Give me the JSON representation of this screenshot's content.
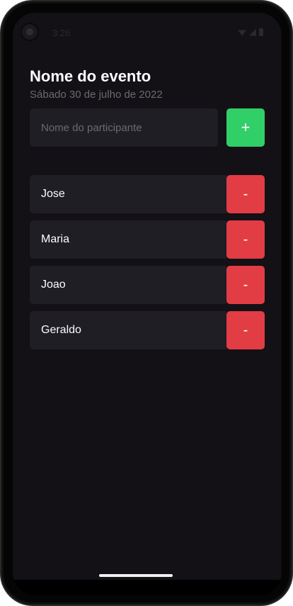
{
  "status_bar": {
    "time": "3:26",
    "icons": [
      "wifi-icon",
      "signal-icon",
      "battery-icon"
    ]
  },
  "event": {
    "title": "Nome do evento",
    "date": "Sábado 30 de julho de 2022"
  },
  "form": {
    "placeholder": "Nome do participante",
    "value": "",
    "add_label": "+"
  },
  "participants": [
    {
      "name": "Jose",
      "remove_label": "-"
    },
    {
      "name": "Maria",
      "remove_label": "-"
    },
    {
      "name": "Joao",
      "remove_label": "-"
    },
    {
      "name": "Geraldo",
      "remove_label": "-"
    }
  ],
  "colors": {
    "background": "#131016",
    "surface": "#1f1e25",
    "add": "#31cf67",
    "remove": "#e23c44",
    "muted_text": "#6b6b6b"
  }
}
